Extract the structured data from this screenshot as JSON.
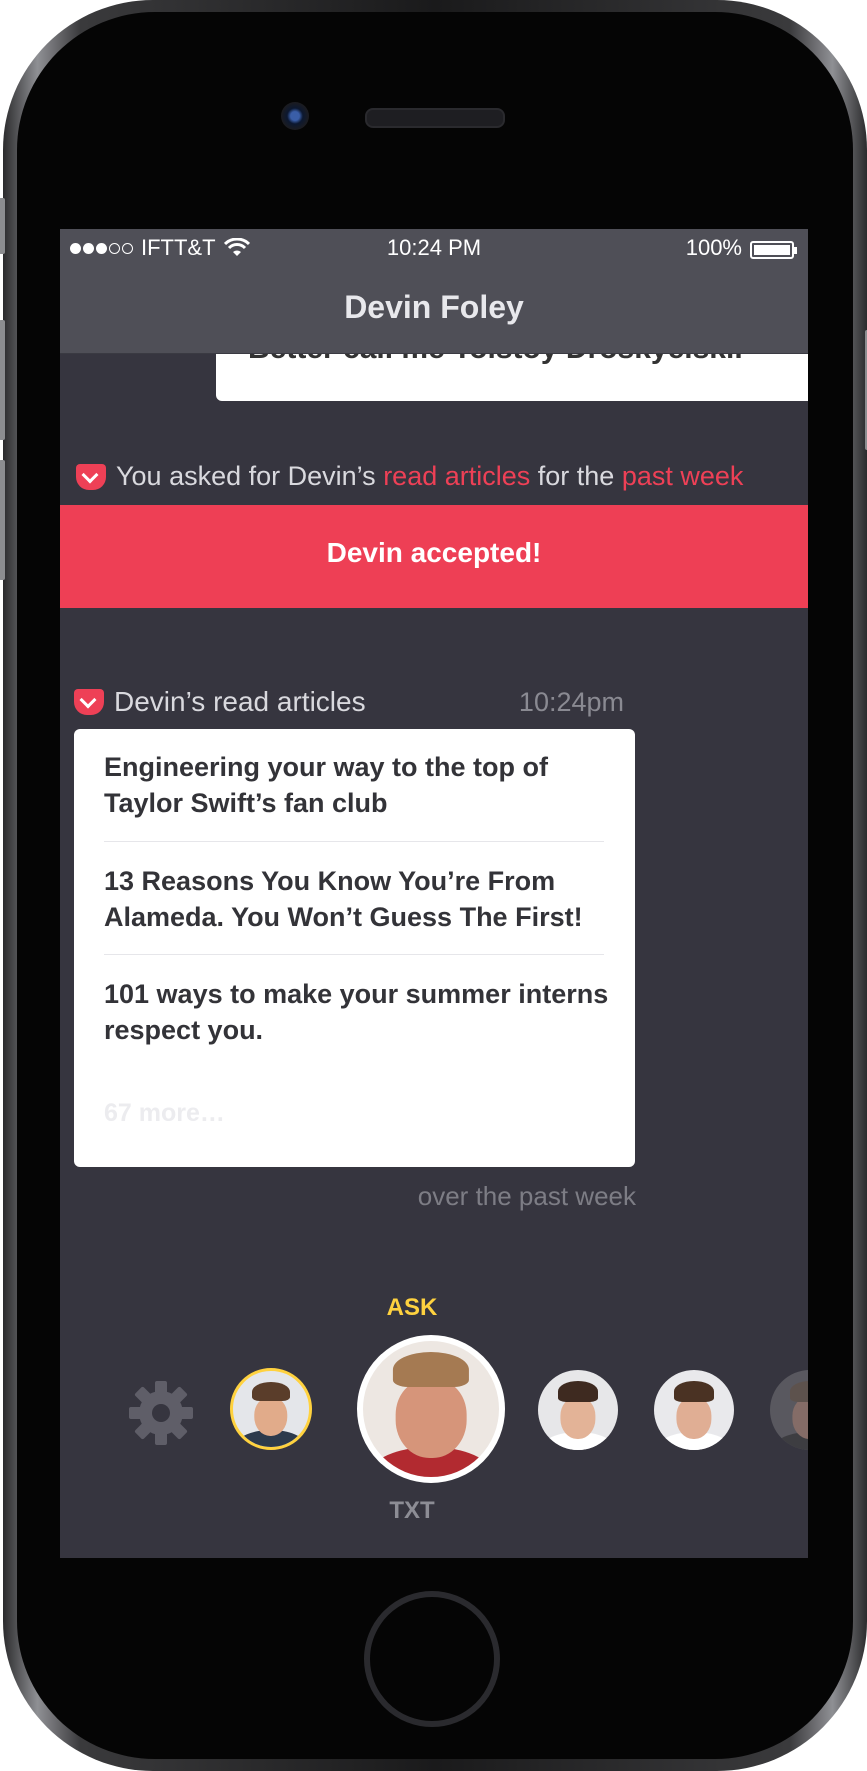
{
  "status_bar": {
    "carrier": "IFTT&T",
    "time": "10:24 PM",
    "battery": "100%",
    "battery_level": 1.0
  },
  "nav": {
    "title": "Devin Foley"
  },
  "previous_message": {
    "text": "Better call me Tolstoy Droskyelski."
  },
  "request": {
    "prefix": "You asked for Devin’s",
    "highlight1": "read articles",
    "middle": "for the",
    "highlight2": "past week"
  },
  "accepted": {
    "text": "Devin accepted!"
  },
  "feed": {
    "title": "Devin’s read articles",
    "time": "10:24pm",
    "articles": [
      "Engineering your way to the top of Taylor Swift’s fan club",
      "13 Reasons You Know You’re From Alameda. You Won’t Guess The First!",
      "101 ways to make your summer interns respect you."
    ],
    "more": "67 more…",
    "footer": "over the past week"
  },
  "contacts": {
    "ask_label": "ASK",
    "txt_label": "TXT"
  },
  "colors": {
    "accent_red": "#ee3f55",
    "ask_yellow": "#ffd23f",
    "background": "#36353f",
    "nav_bg": "#4f4f57"
  },
  "icons": [
    "pocket-icon",
    "gear-icon",
    "wifi-icon",
    "battery-icon"
  ]
}
